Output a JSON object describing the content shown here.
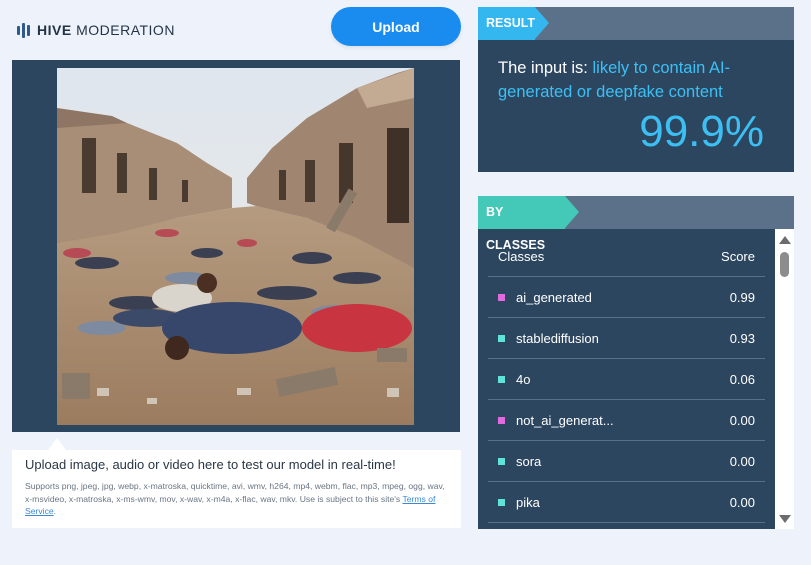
{
  "logo": {
    "brand": "HIVE",
    "product": "MODERATION"
  },
  "upload_button": {
    "label": "Upload"
  },
  "upload_info": {
    "title": "Upload image, audio or video here to test our model in real-time!",
    "formats": "Supports png, jpeg, jpg, webp, x-matroska, quicktime, avi, wmv, h264, mp4, webm, flac, mp3, mpeg, ogg, wav, x-msvideo, x-matroska, x-ms-wmv, mov, x-wav, x-m4a, x-flac, wav, mkv. Use is subject to this site's",
    "terms_link": "Terms of Service",
    "terms_suffix": "."
  },
  "result": {
    "tab_label": "RESULT",
    "prefix": "The input is:",
    "verdict": "likely to contain AI-generated or deepfake content",
    "score": "99.9%"
  },
  "classes": {
    "tab_label": "BY CLASSES",
    "header": {
      "name": "Classes",
      "score": "Score"
    },
    "rows": [
      {
        "name": "ai_generated",
        "score": "0.99",
        "marker_color": "#e26adf"
      },
      {
        "name": "stablediffusion",
        "score": "0.93",
        "marker_color": "#5fe3d6"
      },
      {
        "name": "4o",
        "score": "0.06",
        "marker_color": "#5fe3d6"
      },
      {
        "name": "not_ai_generat...",
        "score": "0.00",
        "marker_color": "#e26adf"
      },
      {
        "name": "sora",
        "score": "0.00",
        "marker_color": "#5fe3d6"
      },
      {
        "name": "pika",
        "score": "0.00",
        "marker_color": "#5fe3d6"
      }
    ]
  },
  "colors": {
    "accent_blue": "#34b6ef",
    "accent_teal": "#44c8b8",
    "panel_bg": "#2d4660",
    "button_blue": "#1a8cf0"
  }
}
